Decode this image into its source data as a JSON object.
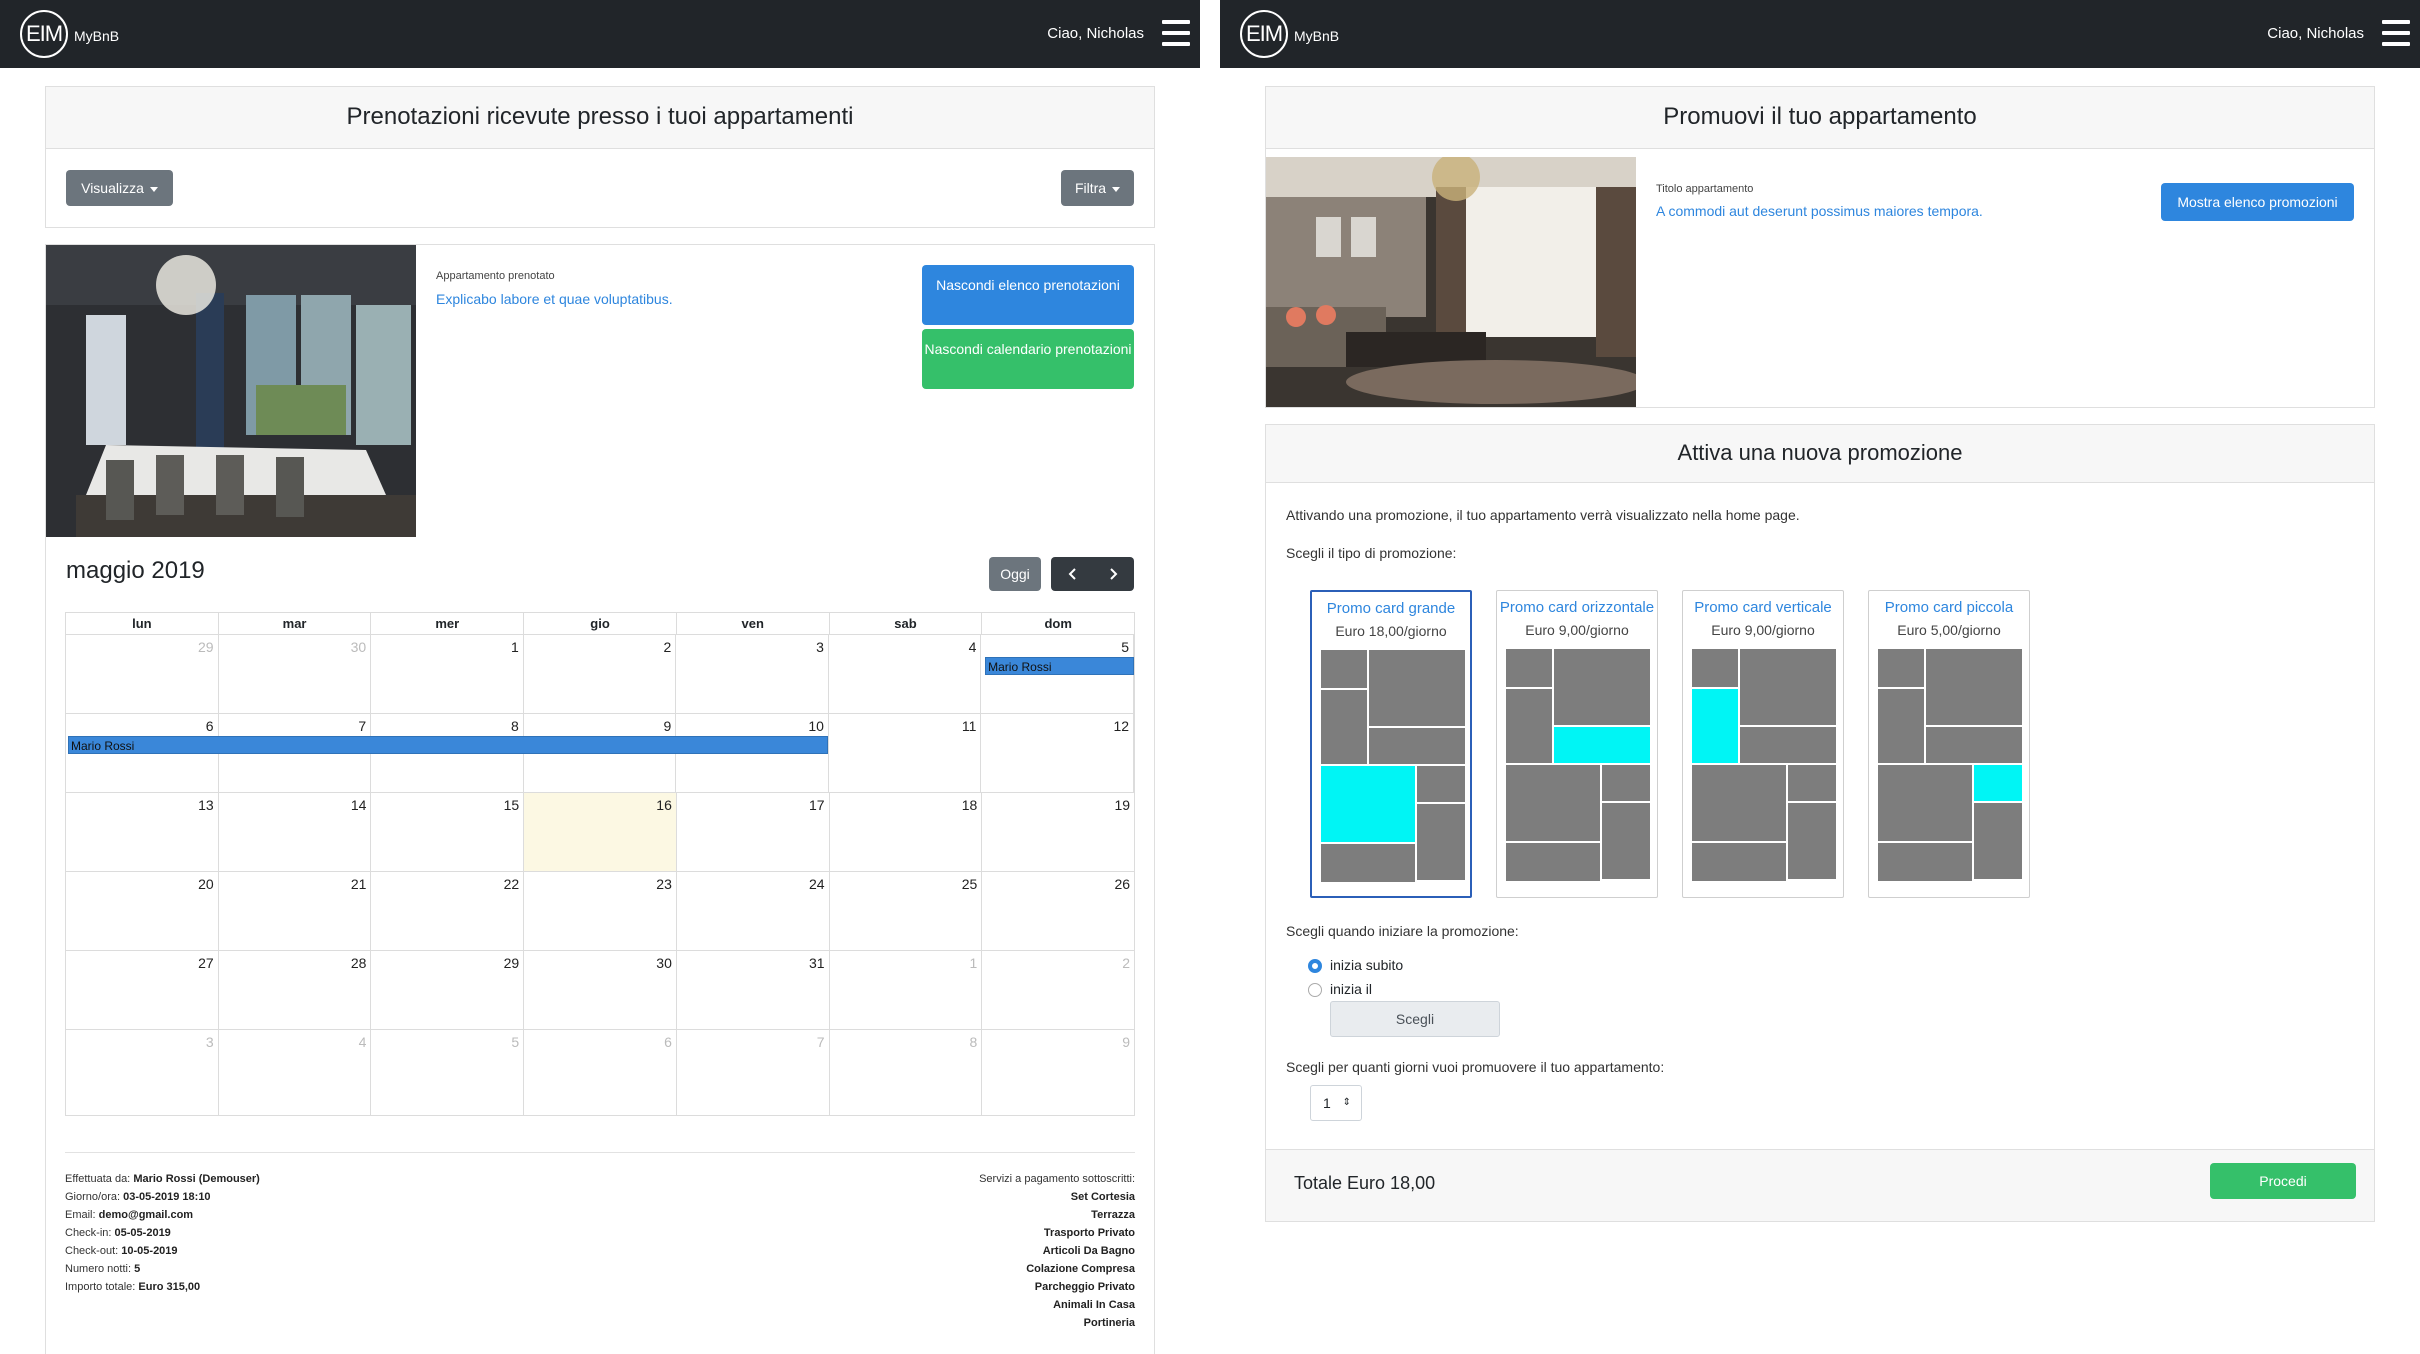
{
  "left": {
    "nav": {
      "logo": "EIM",
      "brand": "MyBnB",
      "greeting": "Ciao, Nicholas"
    },
    "title": "Prenotazioni ricevute presso i tuoi appartamenti",
    "view_button": "Visualizza",
    "filter_button": "Filtra",
    "booked_label": "Appartamento prenotato",
    "booked_title": "Explicabo labore et quae voluptatibus.",
    "hide_list_button": "Nascondi elenco prenotazioni",
    "hide_calendar_button": "Nascondi calendario prenotazioni",
    "calendar": {
      "month": "maggio 2019",
      "today_button": "Oggi",
      "prev_icon": "chevron-left-icon",
      "next_icon": "chevron-right-icon",
      "weekdays": [
        "lun",
        "mar",
        "mer",
        "gio",
        "ven",
        "sab",
        "dom"
      ],
      "weeks": [
        [
          "29",
          "30",
          "1",
          "2",
          "3",
          "4",
          "5"
        ],
        [
          "6",
          "7",
          "8",
          "9",
          "10",
          "11",
          "12"
        ],
        [
          "13",
          "14",
          "15",
          "16",
          "17",
          "18",
          "19"
        ],
        [
          "20",
          "21",
          "22",
          "23",
          "24",
          "25",
          "26"
        ],
        [
          "27",
          "28",
          "29",
          "30",
          "31",
          "1",
          "2"
        ],
        [
          "3",
          "4",
          "5",
          "6",
          "7",
          "8",
          "9"
        ]
      ],
      "today": "16",
      "events": [
        {
          "label": "Mario Rossi",
          "start": "2019-05-05",
          "end": "2019-05-05"
        },
        {
          "label": "Mario Rossi",
          "start": "2019-05-06",
          "end": "2019-05-10"
        }
      ]
    },
    "booking": {
      "made_by_label": "Effettuata da:",
      "made_by": "Mario Rossi (Demouser)",
      "datetime_label": "Giorno/ora:",
      "datetime": "03-05-2019 18:10",
      "email_label": "Email:",
      "email": "demo@gmail.com",
      "checkin_label": "Check-in:",
      "checkin": "05-05-2019",
      "checkout_label": "Check-out:",
      "checkout": "10-05-2019",
      "nights_label": "Numero notti:",
      "nights": "5",
      "total_label": "Importo totale:",
      "total": "Euro 315,00"
    },
    "services_label": "Servizi a pagamento sottoscritti:",
    "services": [
      "Set Cortesia",
      "Terrazza",
      "Trasporto Privato",
      "Articoli Da Bagno",
      "Colazione Compresa",
      "Parcheggio Privato",
      "Animali In Casa",
      "Portineria"
    ]
  },
  "right": {
    "nav": {
      "logo": "EIM",
      "brand": "MyBnB",
      "greeting": "Ciao, Nicholas"
    },
    "title": "Promuovi il tuo appartamento",
    "apt_label": "Titolo appartamento",
    "apt_title": "A commodi aut deserunt possimus maiores tempora.",
    "show_promos_button": "Mostra elenco promozioni",
    "new_promo_title": "Attiva una nuova promozione",
    "intro": "Attivando una promozione, il tuo appartamento verrà visualizzato nella home page.",
    "choose_type": "Scegli il tipo di promozione:",
    "promos": [
      {
        "name": "Promo card grande",
        "price": "Euro 18,00/giorno",
        "selected": true
      },
      {
        "name": "Promo card orizzontale",
        "price": "Euro 9,00/giorno",
        "selected": false
      },
      {
        "name": "Promo card verticale",
        "price": "Euro 9,00/giorno",
        "selected": false
      },
      {
        "name": "Promo card piccola",
        "price": "Euro 5,00/giorno",
        "selected": false
      }
    ],
    "choose_start": "Scegli quando iniziare la promozione:",
    "start_now": "inizia subito",
    "start_on": "inizia il",
    "choose_button": "Scegli",
    "choose_days": "Scegli per quanti giorni vuoi promuovere il tuo appartamento:",
    "days_value": "1",
    "total": "Totale Euro 18,00",
    "proceed_button": "Procedi"
  }
}
